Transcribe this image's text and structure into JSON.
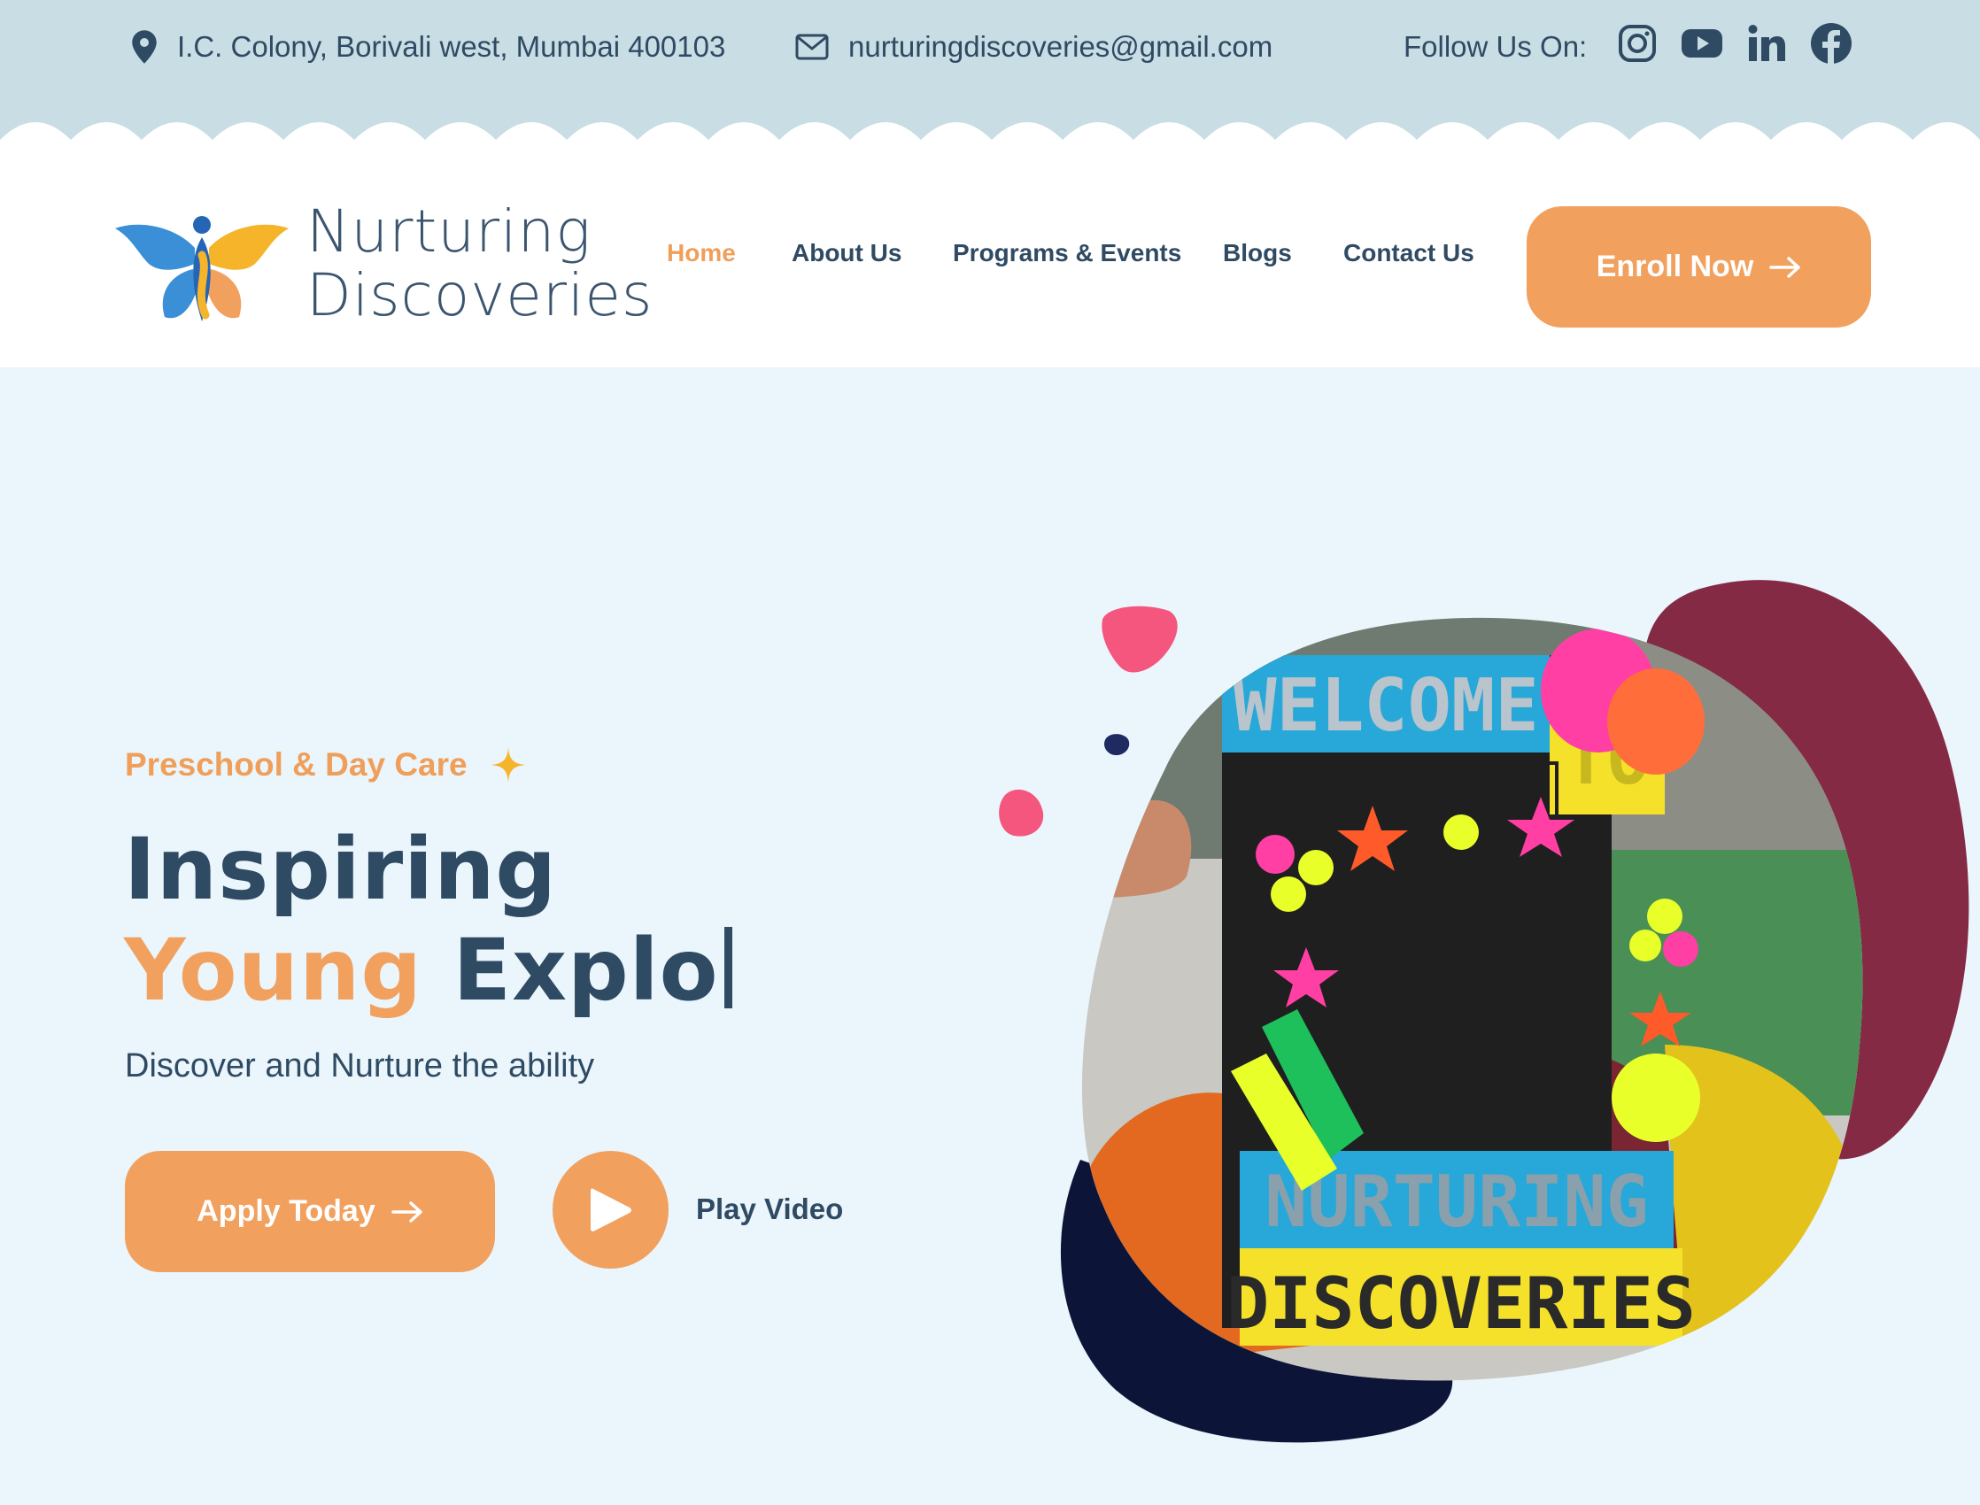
{
  "topbar": {
    "address": "I.C. Colony, Borivali west, Mumbai 400103",
    "email": "nurturingdiscoveries@gmail.com",
    "follow_label": "Follow Us On:",
    "social_icons": [
      "instagram-icon",
      "youtube-icon",
      "linkedin-icon",
      "facebook-icon"
    ]
  },
  "header": {
    "logo": {
      "line1": "Nurturing",
      "line2": "Discoveries"
    },
    "nav": [
      "Home",
      "About Us",
      "Programs & Events",
      "Blogs",
      "Contact Us"
    ],
    "active_nav": "Home",
    "cta_label": "Enroll Now"
  },
  "hero": {
    "eyebrow": "Preschool & Day Care",
    "headline_line1": "Inspiring",
    "headline_accent": "Young",
    "headline_typed": "Explo",
    "subtitle": "Discover and Nurture the ability",
    "apply_label": "Apply Today",
    "play_label": "Play Video"
  },
  "photo": {
    "frame_top": "WELCOME",
    "frame_to": "TO",
    "frame_mid": "NURTURING",
    "frame_bottom": "DISCOVERIES"
  },
  "colors": {
    "topbar_bg": "#c9dde4",
    "hero_bg": "#eaf6fc",
    "accent_orange": "#f2a05e",
    "text_navy": "#2f4a63",
    "blob_maroon": "#852a45",
    "blob_navy": "#0c1437",
    "blob_pink": "#f4567d"
  }
}
